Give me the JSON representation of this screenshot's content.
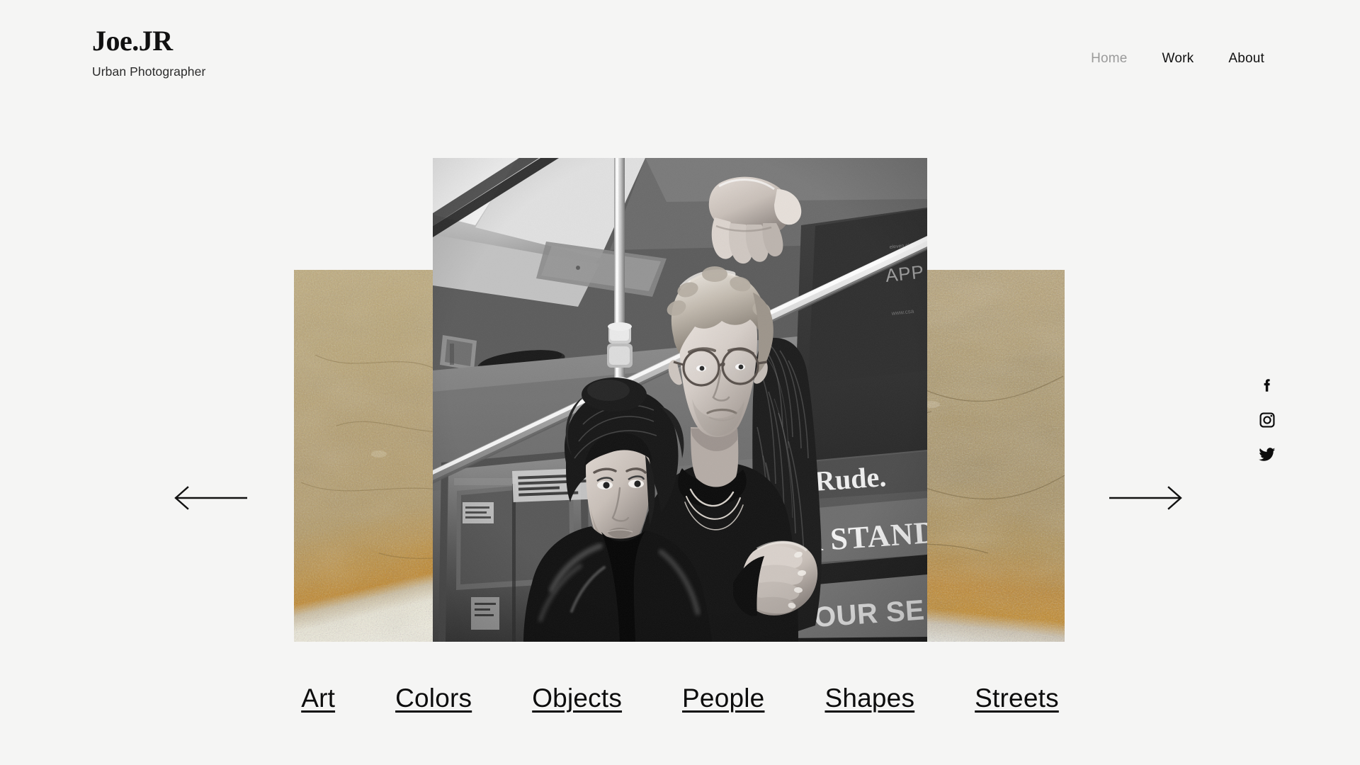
{
  "site": {
    "background_color": "#f5f5f4",
    "text_color": "#111111"
  },
  "header": {
    "brand_name": "Joe.JR",
    "brand_tagline": "Urban Photographer",
    "nav": [
      {
        "label": "Home",
        "state": "muted",
        "color": "#9a9a9a"
      },
      {
        "label": "Work",
        "state": "normal",
        "color": "#111111"
      },
      {
        "label": "About",
        "state": "normal",
        "color": "#111111"
      }
    ]
  },
  "carousel": {
    "prev_label": "Previous photo",
    "prev_icon": "arrow-left-icon",
    "next_label": "Next photo",
    "next_icon": "arrow-right-icon",
    "hero": {
      "alt": "Black and white photograph of a couple standing on a subway train, man holding the overhead rail",
      "style": "black-and-white",
      "ad_text_lines": [
        "Rude.",
        "A STAND",
        "YOUR SE"
      ],
      "ad_text_small": [
        "APP"
      ]
    },
    "backdrop_left": {
      "alt": "Textured gold and cream painted wall panel",
      "top_color": "#b9a16b",
      "accent_color": "#c08a2e",
      "bottom_color": "#efeadc"
    },
    "backdrop_right": {
      "alt": "Textured gold and cream painted wall panel",
      "top_color": "#b09a68",
      "accent_color": "#bf8529",
      "bottom_color": "#e8e7df"
    }
  },
  "social": [
    {
      "name": "facebook",
      "icon": "facebook-icon",
      "label": "Facebook"
    },
    {
      "name": "instagram",
      "icon": "instagram-icon",
      "label": "Instagram"
    },
    {
      "name": "twitter",
      "icon": "twitter-icon",
      "label": "Twitter"
    }
  ],
  "categories": [
    {
      "label": "Art"
    },
    {
      "label": "Colors"
    },
    {
      "label": "Objects"
    },
    {
      "label": "People"
    },
    {
      "label": "Shapes"
    },
    {
      "label": "Streets"
    }
  ]
}
